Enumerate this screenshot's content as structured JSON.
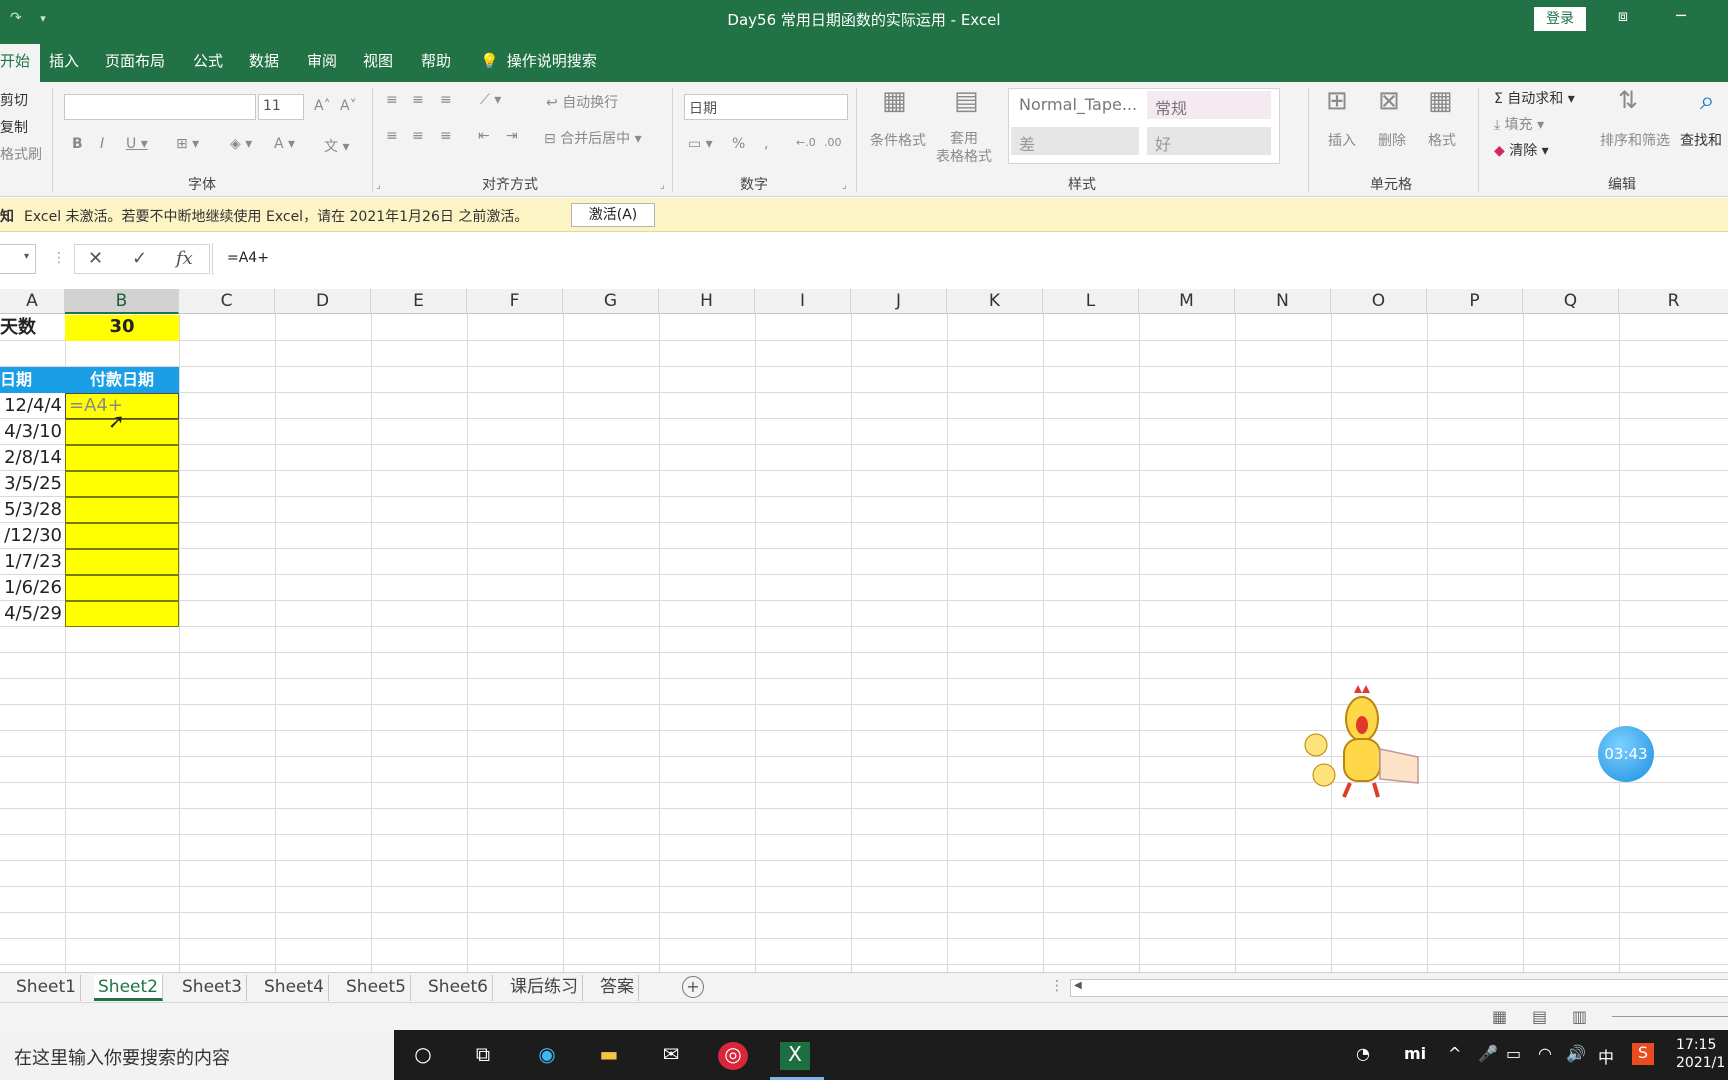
{
  "window": {
    "title": "Day56 常用日期函数的实际运用  -  Excel",
    "login_label": "登录"
  },
  "tabs": {
    "home": "开始",
    "items": [
      "插入",
      "页面布局",
      "公式",
      "数据",
      "审阅",
      "视图",
      "帮助"
    ],
    "tell_me": "操作说明搜索"
  },
  "ribbon": {
    "clipboard": {
      "cut": "剪切",
      "copy": "复制",
      "format_painter": "格式刷"
    },
    "font": {
      "label": "字体",
      "size": "11"
    },
    "alignment": {
      "label": "对齐方式",
      "wrap_text": "自动换行",
      "merge_center": "合并后居中"
    },
    "number": {
      "label": "数字",
      "format": "日期"
    },
    "styles": {
      "label": "样式",
      "conditional": "条件格式",
      "table_format": "套用\n表格格式",
      "normal_tape": "Normal_Tape...",
      "normal": "常规",
      "bad": "差",
      "good": "好"
    },
    "cells": {
      "label": "单元格",
      "insert": "插入",
      "delete": "删除",
      "format": "格式"
    },
    "editing": {
      "label": "编辑",
      "autosum": "自动求和",
      "fill": "填充",
      "clear": "清除",
      "sort_filter": "排序和筛选",
      "find_select": "查找和"
    }
  },
  "message_bar": {
    "prefix": "知",
    "text": "Excel 未激活。若要不中断地继续使用 Excel，请在 2021年1月26日 之前激活。",
    "activate": "激活(A)"
  },
  "formula_bar": {
    "value": "=A4+"
  },
  "grid": {
    "columns": [
      "A",
      "B",
      "C",
      "D",
      "E",
      "F",
      "G",
      "H",
      "I",
      "J",
      "K",
      "L",
      "M",
      "N",
      "O",
      "P",
      "Q",
      "R"
    ],
    "row1_label": "天数",
    "row1_value": "30",
    "header_a": "日期",
    "header_b": "付款日期",
    "dates": [
      "12/4/4",
      "4/3/10",
      "2/8/14",
      "3/5/25",
      "5/3/28",
      "/12/30",
      "1/7/23",
      "1/6/26",
      "4/5/29"
    ],
    "editing_cell": "=A4+"
  },
  "sheets": [
    "Sheet1",
    "Sheet2",
    "Sheet3",
    "Sheet4",
    "Sheet5",
    "Sheet6",
    "课后练习",
    "答案"
  ],
  "active_sheet": "Sheet2",
  "timer": "03:43",
  "taskbar": {
    "search_placeholder": "在这里输入你要搜索的内容",
    "tray_ime": "中",
    "time": "17:15",
    "date": "2021/1"
  },
  "colors": {
    "excel_green": "#217346",
    "cell_yellow": "#ffff00",
    "header_blue": "#1a9ee6"
  }
}
